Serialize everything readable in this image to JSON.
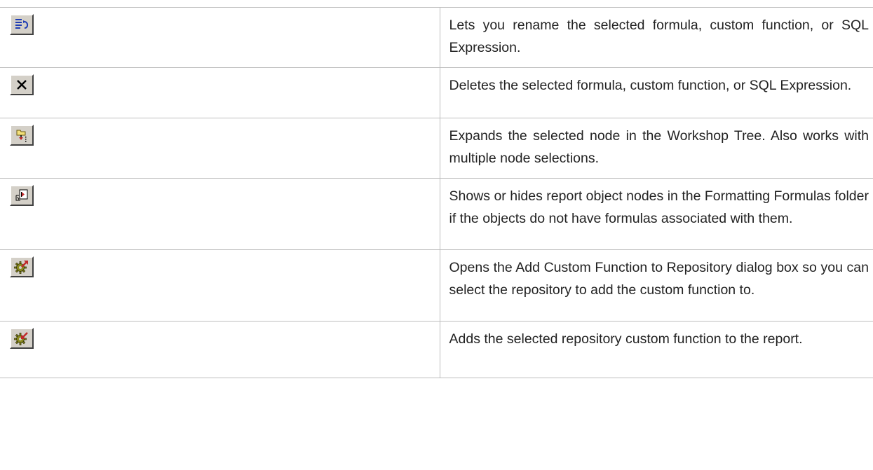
{
  "rows": [
    {
      "icon": "rename-icon",
      "description": "Lets you rename the selected formula, custom function, or SQL Expression."
    },
    {
      "icon": "delete-icon",
      "description": "Deletes the selected formula, custom function, or SQL Expression."
    },
    {
      "icon": "expand-node-icon",
      "description": "Expands the selected node in the Workshop Tree. Also works with multiple node selections."
    },
    {
      "icon": "show-hide-report-objects-icon",
      "description": "Shows or hides report object nodes in the Formatting Formulas folder if the objects do not have formulas associated with them."
    },
    {
      "icon": "add-to-repository-icon",
      "description": "Opens the Add Custom Function to Repository dialog box so you can select the repository to add the custom function to."
    },
    {
      "icon": "add-to-report-icon",
      "description": "Adds the selected repository custom function to the report."
    }
  ],
  "colors": {
    "button_face": "#d4d0c8",
    "gear": "#8a8a1e",
    "arrow": "#c0282a",
    "border": "#bdbdbd"
  }
}
